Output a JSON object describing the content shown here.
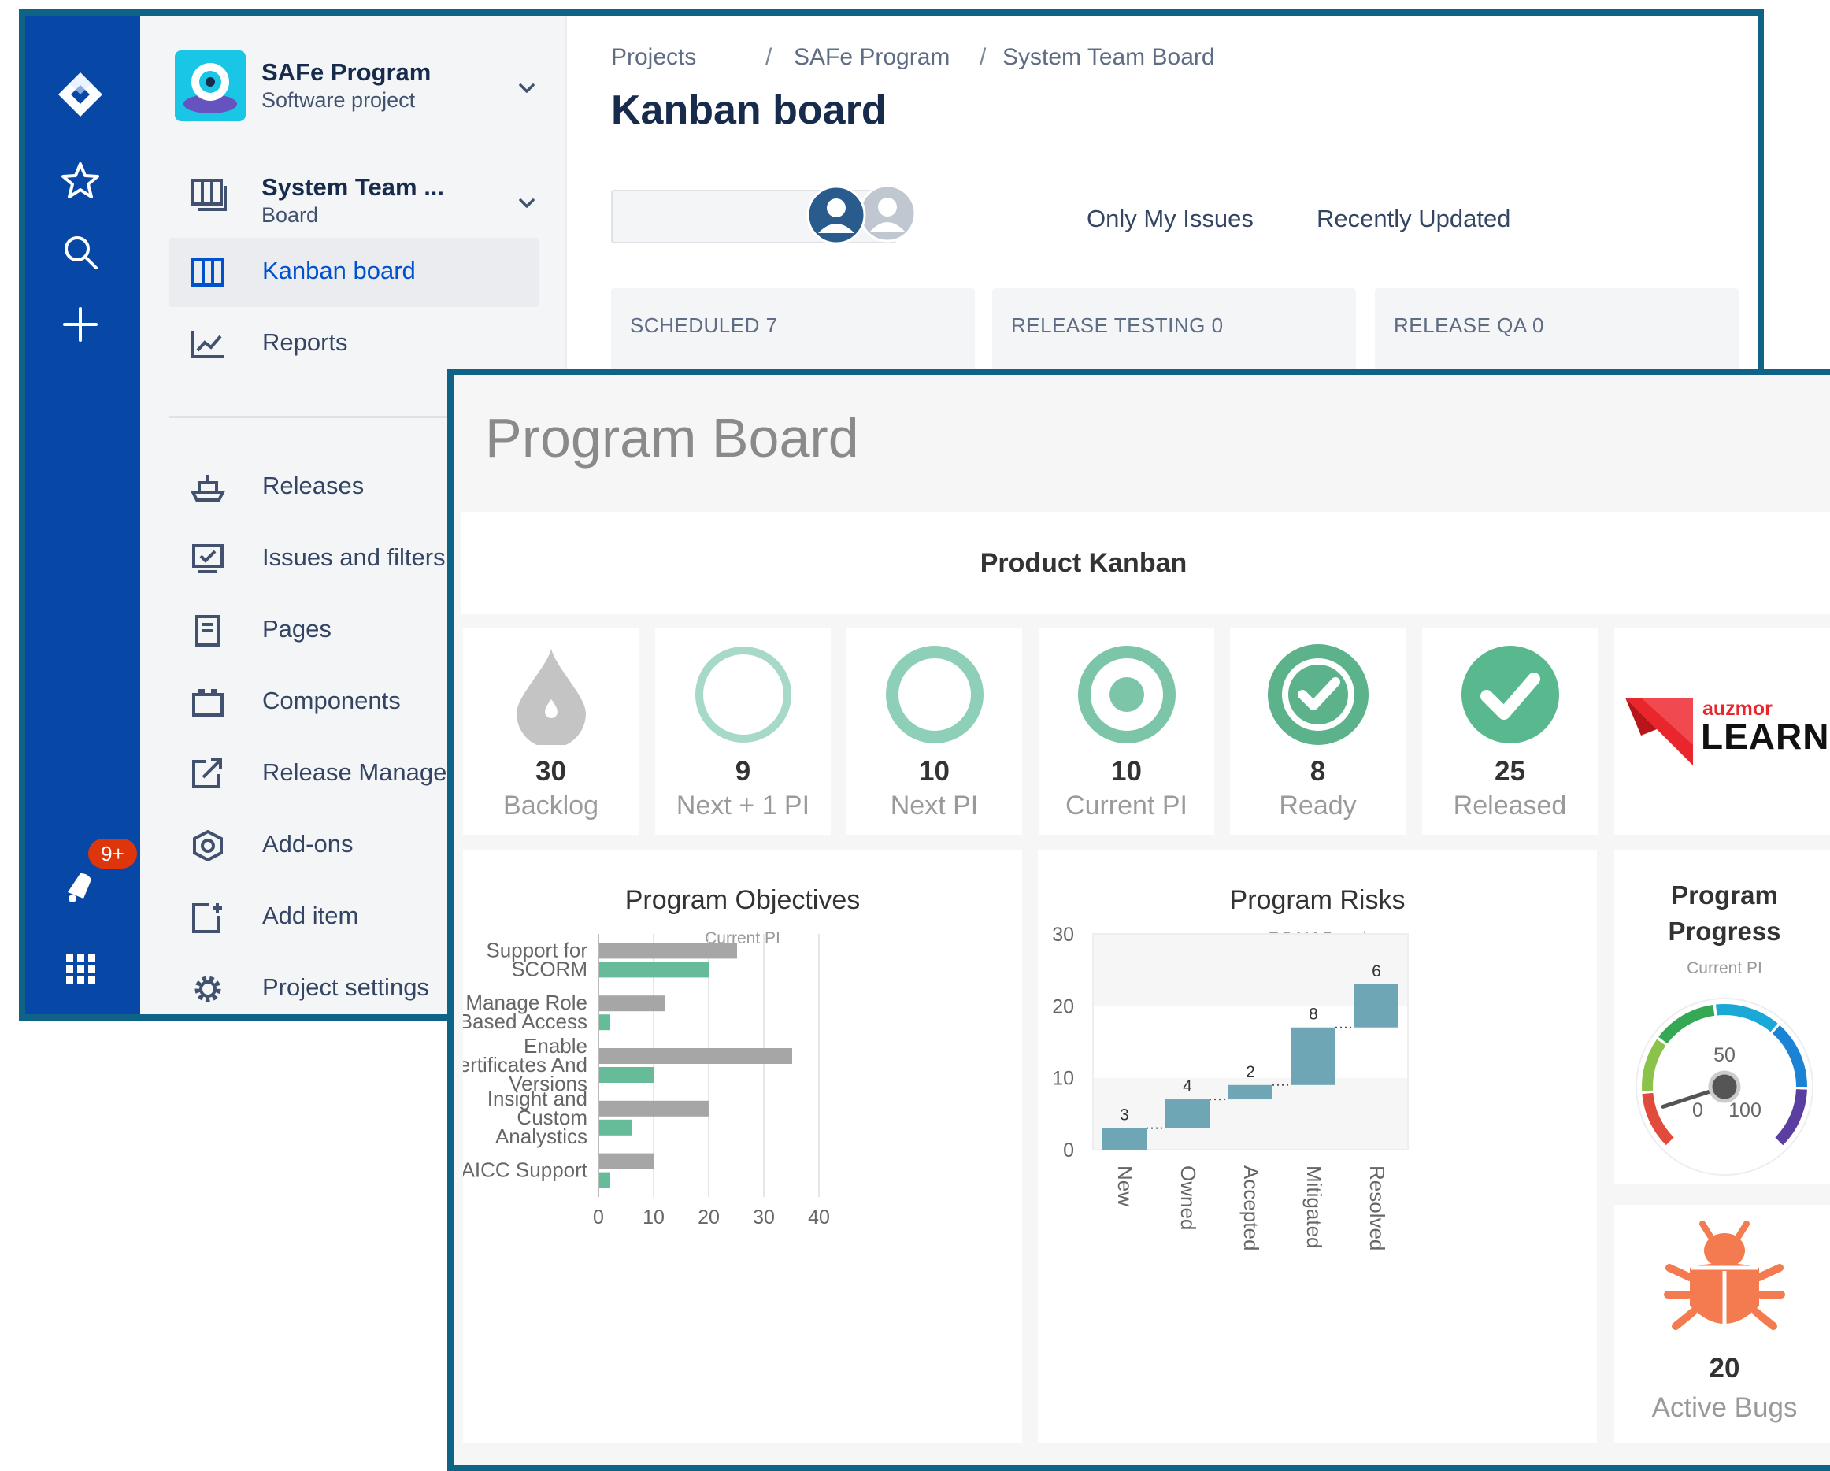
{
  "jira": {
    "notification_badge": "9+",
    "project": {
      "name": "SAFe Program",
      "type": "Software project"
    },
    "board_switcher": {
      "name": "System Team ...",
      "type": "Board"
    },
    "nav": [
      {
        "label": "Kanban board",
        "icon": "board-columns-icon",
        "active": true
      },
      {
        "label": "Reports",
        "icon": "chart-line-icon"
      }
    ],
    "nav2": [
      {
        "label": "Releases",
        "icon": "ship-icon"
      },
      {
        "label": "Issues and filters",
        "icon": "monitor-check-icon"
      },
      {
        "label": "Pages",
        "icon": "page-icon"
      },
      {
        "label": "Components",
        "icon": "component-icon"
      },
      {
        "label": "Release Manage",
        "icon": "external-link-icon"
      },
      {
        "label": "Add-ons",
        "icon": "hexagon-icon"
      },
      {
        "label": "Add item",
        "icon": "add-item-icon"
      },
      {
        "label": "Project settings",
        "icon": "gear-icon"
      }
    ],
    "breadcrumbs": [
      "Projects",
      "SAFe Program",
      "System Team Board"
    ],
    "page_title": "Kanban board",
    "search": {
      "value": "",
      "placeholder": ""
    },
    "filters": [
      "Only My Issues",
      "Recently Updated"
    ],
    "columns": [
      {
        "name": "SCHEDULED",
        "count": "7"
      },
      {
        "name": "RELEASE TESTING",
        "count": "0"
      },
      {
        "name": "RELEASE QA",
        "count": "0"
      }
    ]
  },
  "program": {
    "title": "Program Board",
    "kanban_title": "Product Kanban",
    "stages": [
      {
        "count": "30",
        "label": "Backlog",
        "icon": "drop-icon",
        "color": "#c4c4c4"
      },
      {
        "count": "9",
        "label": "Next + 1 PI",
        "icon": "ring-icon",
        "color": "#a6d9c8"
      },
      {
        "count": "10",
        "label": "Next PI",
        "icon": "ring-icon",
        "color": "#8ecfb8"
      },
      {
        "count": "10",
        "label": "Current PI",
        "icon": "target-icon",
        "color": "#7cc5a9"
      },
      {
        "count": "8",
        "label": "Ready",
        "icon": "check-ring-icon",
        "color": "#5cb28a"
      },
      {
        "count": "25",
        "label": "Released",
        "icon": "check-filled-icon",
        "color": "#5ab88f"
      }
    ],
    "brand": {
      "small": "auzmor",
      "large": "LEARN",
      "color": "#e8262c"
    },
    "objectives": {
      "title": "Program Objectives",
      "subtitle": "Current PI"
    },
    "risks": {
      "title": "Program Risks",
      "subtitle": "ROAM Board"
    },
    "progress": {
      "title_line1": "Program",
      "title_line2": "Progress",
      "subtitle": "Current PI",
      "gauge_mid": "50",
      "gauge_min": "0",
      "gauge_max": "100",
      "value": 10
    },
    "bugs": {
      "count": "20",
      "label": "Active Bugs",
      "color": "#f47a4f"
    }
  },
  "chart_data": [
    {
      "type": "bar",
      "title": "Program Objectives",
      "subtitle": "Current PI",
      "orientation": "horizontal",
      "categories": [
        [
          "Support for",
          "SCORM"
        ],
        [
          "Manage Role",
          "Based Access"
        ],
        [
          "Enable",
          "Certificates And",
          "Versions"
        ],
        [
          "Insight and",
          "Custom",
          "Analystics"
        ],
        [
          "AICC Support"
        ]
      ],
      "series": [
        {
          "values": [
            25,
            12,
            35,
            20,
            10
          ],
          "color": "#a6a6a6"
        },
        {
          "values": [
            20,
            2,
            10,
            6,
            2
          ],
          "color": "#66bb99"
        }
      ],
      "xlim": [
        0,
        40
      ],
      "xticks": [
        0,
        10,
        20,
        30,
        40
      ]
    },
    {
      "type": "bar",
      "subtype": "waterfall",
      "title": "Program Risks",
      "subtitle": "ROAM Board",
      "categories": [
        "New",
        "Owned",
        "Accepted",
        "Mitigated",
        "Resolved"
      ],
      "values": [
        3,
        4,
        2,
        8,
        6
      ],
      "color": "#6fa6b6",
      "ylim": [
        0,
        30
      ],
      "yticks": [
        0,
        10,
        20,
        30
      ]
    }
  ]
}
